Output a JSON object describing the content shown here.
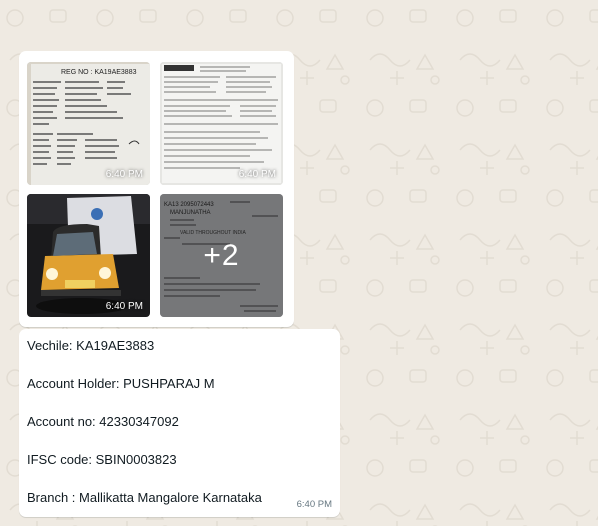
{
  "chat": {
    "album": {
      "images": [
        {
          "name": "registration-certificate-image",
          "time": "6:40 PM"
        },
        {
          "name": "invoice-document-image",
          "time": "6:40 PM"
        },
        {
          "name": "vehicle-photo-image",
          "time": "6:40 PM"
        },
        {
          "name": "bank-cheque-image",
          "more_count": "+2"
        }
      ],
      "doc_text": {
        "reg_no": "REG NO : KA19AE3883",
        "cheque_ac": "KA13 2095072443",
        "cheque_name": "MANJUNATHA",
        "cheque_valid": "VALID THROUGHOUT INDIA"
      }
    },
    "message": {
      "lines": [
        "Vechile: KA19AE3883",
        "Account Holder: PUSHPARAJ M",
        "Account no: 42330347092",
        "IFSC code: SBIN0003823",
        "Branch : Mallikatta Mangalore Karnataka"
      ],
      "time": "6:40 PM"
    }
  },
  "colors": {
    "wallpaper": "#efeae2",
    "bubble": "#ffffff",
    "text": "#111b21",
    "meta": "#667781"
  }
}
